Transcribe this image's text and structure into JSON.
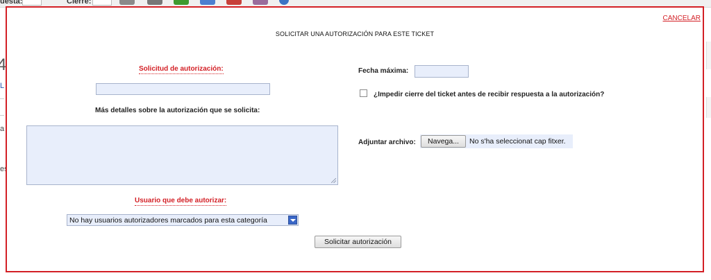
{
  "background": {
    "top_labels": [
      "uesta:",
      "Cierre:"
    ],
    "left_fragments": [
      "L",
      "a",
      "es"
    ],
    "big_char": "4"
  },
  "modal": {
    "cancel_label": "CANCELAR",
    "title": "SOLICITAR UNA AUTORIZACIÓN PARA ESTE TICKET",
    "left": {
      "request_label": "Solicitud de autorización:",
      "request_value": "",
      "details_label": "Más detalles sobre la autorización que se solicita:",
      "details_value": "",
      "user_label": "Usuario que debe autorizar:",
      "user_select_value": "No hay usuarios autorizadores marcados para esta categoría"
    },
    "right": {
      "max_date_label": "Fecha máxima:",
      "max_date_value": "",
      "prevent_close_label": "¿Impedir cierre del ticket antes de recibir respuesta a la autorización?",
      "prevent_close_checked": false,
      "attach_label": "Adjuntar archivo:",
      "browse_button": "Navega...",
      "file_status": "No s'ha seleccionat cap fitxer."
    },
    "submit_button": "Solicitar autorización"
  },
  "colors": {
    "accent_red": "#d31f25",
    "input_bg": "#e8eefb",
    "select_arrow": "#3a67c7"
  }
}
